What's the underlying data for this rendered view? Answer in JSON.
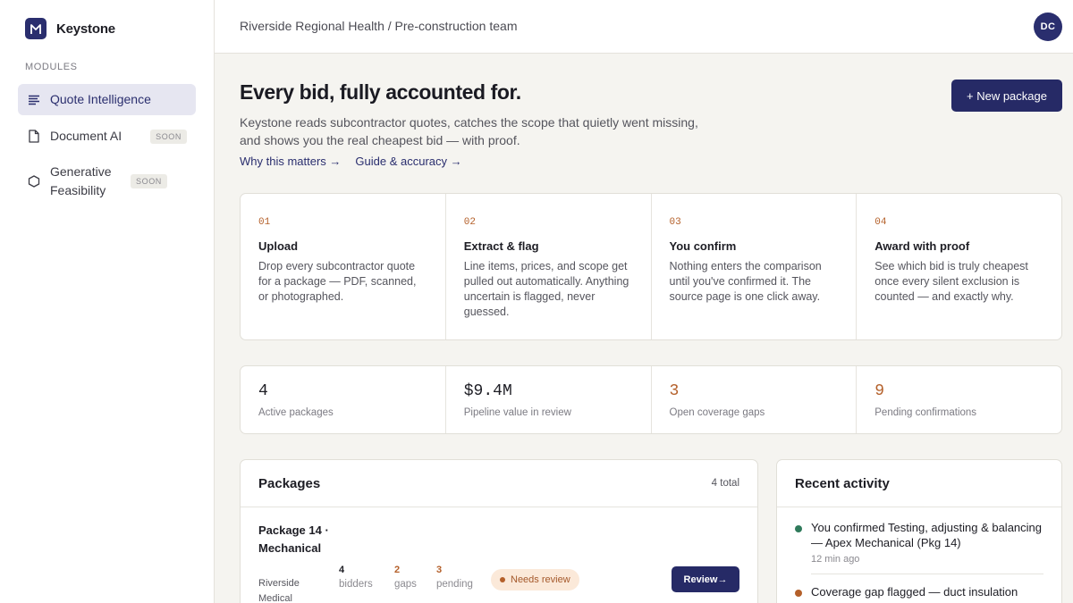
{
  "sidebar": {
    "brand": "Keystone",
    "modules_label": "MODULES",
    "items": [
      {
        "label": "Quote Intelligence",
        "active": true,
        "icon": "lines-icon"
      },
      {
        "label": "Document AI",
        "badge": "SOON",
        "icon": "document-icon"
      },
      {
        "label": "Generative Feasibility",
        "badge": "SOON",
        "icon": "hexagon-icon"
      }
    ]
  },
  "topbar": {
    "breadcrumb": "Riverside Regional Health / Pre-construction team",
    "avatar_initials": "DC"
  },
  "hero": {
    "title": "Every bid, fully accounted for.",
    "subtitle": "Keystone reads subcontractor quotes, catches the scope that quietly went missing, and shows you the real cheapest bid — with proof.",
    "links": [
      "Why this matters →",
      "Guide & accuracy →"
    ],
    "new_package_label": "+ New package"
  },
  "steps": [
    {
      "num": "01",
      "title": "Upload",
      "desc": "Drop every subcontractor quote for a package — PDF, scanned, or photographed."
    },
    {
      "num": "02",
      "title": "Extract & flag",
      "desc": "Line items, prices, and scope get pulled out automatically. Anything uncertain is flagged, never guessed."
    },
    {
      "num": "03",
      "title": "You confirm",
      "desc": "Nothing enters the comparison until you've confirmed it. The source page is one click away."
    },
    {
      "num": "04",
      "title": "Award with proof",
      "desc": "See which bid is truly cheapest once every silent exclusion is counted — and exactly why."
    }
  ],
  "stats": [
    {
      "value": "4",
      "label": "Active packages"
    },
    {
      "value": "$9.4M",
      "label": "Pipeline value in review"
    },
    {
      "value": "3",
      "label": "Open coverage gaps"
    },
    {
      "value": "9",
      "label": "Pending confirmations"
    }
  ],
  "packages": {
    "title": "Packages",
    "count": "4 total",
    "rows": [
      {
        "name": "Package 14 · Mechanical",
        "subtitle": "Riverside Medical",
        "bidders": "4",
        "bidders_label": "bidders",
        "gaps": "2",
        "gaps_label": "gaps",
        "pending": "3",
        "pending_label": "pending",
        "status": "Needs review",
        "action": "Review→"
      }
    ]
  },
  "activity": {
    "title": "Recent activity",
    "items": [
      {
        "text": "You confirmed Testing, adjusting & balancing — Apex Mechanical (Pkg 14)",
        "time": "12 min ago",
        "color": "#2f7a5b"
      },
      {
        "text": "Coverage gap flagged — duct insulation",
        "time": "",
        "color": "#b4602a"
      }
    ]
  },
  "colors": {
    "accent": "#262a66",
    "warning": "#b4602a",
    "success": "#2f7a5b"
  }
}
